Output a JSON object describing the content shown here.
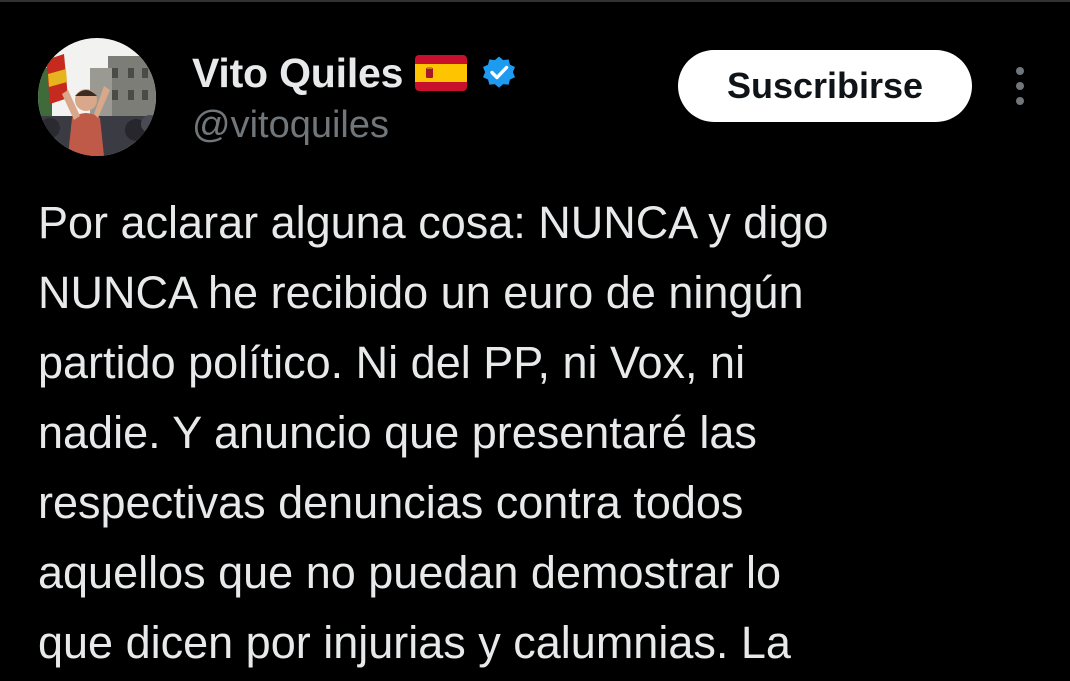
{
  "post": {
    "author": {
      "display_name": "Vito Quiles",
      "handle": "@vitoquiles",
      "flag": "spain-flag-emoji",
      "verified": true
    },
    "subscribe_label": "Suscribirse",
    "text_lines": [
      "Por aclarar alguna cosa: NUNCA y digo",
      "NUNCA he recibido un euro de ningún",
      "partido político. Ni del PP, ni Vox, ni",
      "nadie. Y anuncio que presentaré las",
      "respectivas denuncias contra todos",
      "aquellos que no puedan demostrar lo",
      "que dicen por injurias y calumnias. La"
    ]
  },
  "colors": {
    "background": "#000000",
    "text_primary": "#e7e9ea",
    "text_secondary": "#71767b",
    "verified_blue": "#1d9bf0",
    "button_bg": "#ffffff",
    "button_text": "#0f1419"
  }
}
